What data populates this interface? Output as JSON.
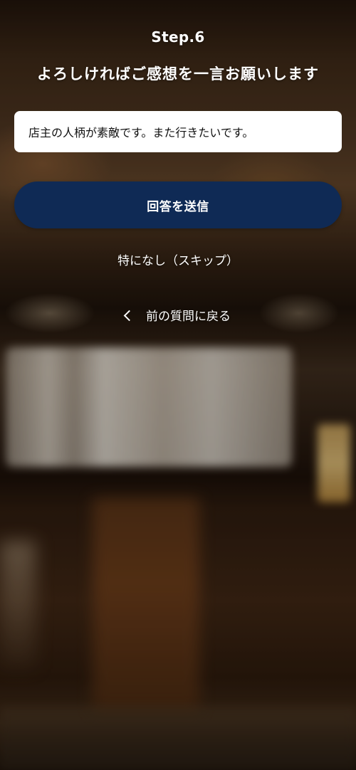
{
  "step_label": "Step.6",
  "question": "よろしければご感想を一言お願いします",
  "comment": {
    "value": "店主の人柄が素敵です。また行きたいです。"
  },
  "submit_label": "回答を送信",
  "skip_label": "特になし（スキップ）",
  "back": {
    "label": "前の質問に戻る",
    "icon": "chevron-left-icon"
  },
  "colors": {
    "primary_button": "#0f2a55",
    "text": "#ffffff",
    "input_background": "#ffffff"
  }
}
